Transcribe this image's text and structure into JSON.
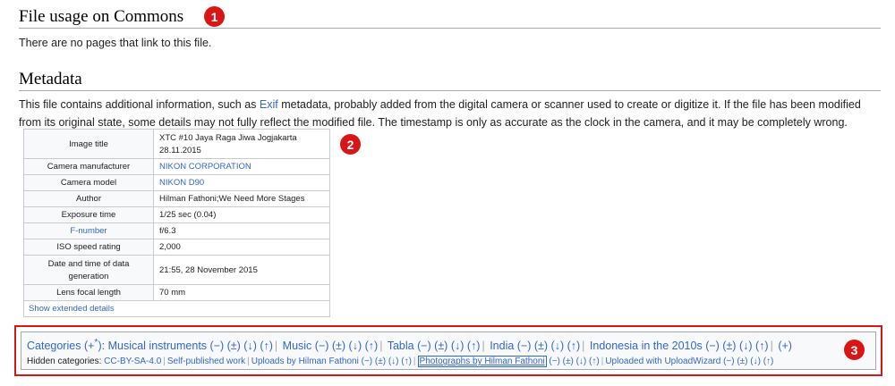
{
  "usage": {
    "heading": "File usage on Commons",
    "text": "There are no pages that link to this file.",
    "marker": "1"
  },
  "metadata": {
    "heading": "Metadata",
    "desc_part1": "This file contains additional information, such as ",
    "desc_link": "Exif",
    "desc_part2": " metadata, probably added from the digital camera or scanner used to create or digitize it. If the file has been modified from its original state, some details may not fully reflect the modified file. The timestamp is only as accurate as the clock in the camera, and it may be completely wrong.",
    "marker": "2",
    "rows": {
      "title_k": "Image title",
      "title_v1": "XTC #10 Jaya Raga Jiwa Jogjakarta",
      "title_v2": "28.11.2015",
      "make_k": "Camera manufacturer",
      "make_v": "NIKON CORPORATION",
      "model_k": "Camera model",
      "model_v": "NIKON D90",
      "author_k": "Author",
      "author_v": "Hilman Fathoni;We Need More Stages",
      "exposure_k": "Exposure time",
      "exposure_v": "1/25 sec (0.04)",
      "fnum_k": "F-number",
      "fnum_v": "f/6.3",
      "iso_k": "ISO speed rating",
      "iso_v": "2,000",
      "date_k1": "Date and time of data",
      "date_k2": "generation",
      "date_v": "21:55, 28 November 2015",
      "focal_k": "Lens focal length",
      "focal_v": "70 mm"
    },
    "show_extended": "Show extended details"
  },
  "categories": {
    "marker": "3",
    "label": "Categories",
    "plus": "(+",
    "plus_sup": "*",
    "plus_end": "):",
    "controls": "(−) (±) (↓) (↑)",
    "items": [
      "Musical instruments",
      "Music",
      "Tabla",
      "India",
      "Indonesia in the 2010s"
    ],
    "add": "(+)",
    "hidden_label": "Hidden categories:",
    "hidden": [
      "CC-BY-SA-4.0",
      "Self-published work",
      "Uploads by Hilman Fathoni",
      "Photographs by Hilman Fathoni",
      "Uploaded with UploadWizard"
    ],
    "hidden_controls": "(−) (±) (↓) (↑)"
  }
}
